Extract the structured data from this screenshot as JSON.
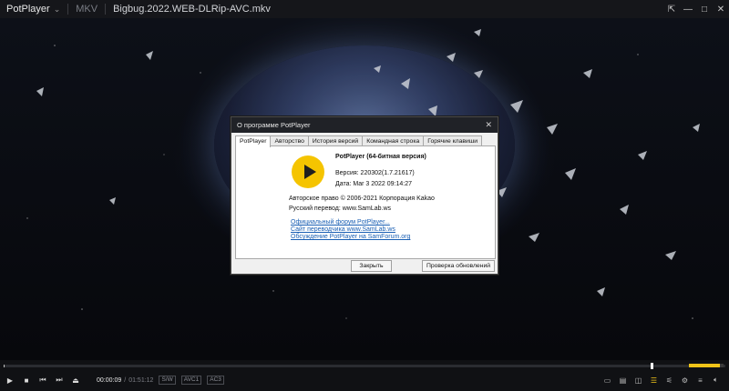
{
  "titlebar": {
    "app_name": "PotPlayer",
    "format": "MKV",
    "filename": "Bigbug.2022.WEB-DLRip-AVC.mkv",
    "controls": [
      "pin-icon",
      "minimize-icon",
      "maximize-icon",
      "close-icon"
    ]
  },
  "dialog": {
    "title": "О программе PotPlayer",
    "tabs": [
      {
        "label": "PotPlayer",
        "active": true
      },
      {
        "label": "Авторство",
        "active": false
      },
      {
        "label": "История версий",
        "active": false
      },
      {
        "label": "Командная строка",
        "active": false
      },
      {
        "label": "Горячие клавиши",
        "active": false
      }
    ],
    "app_name": "PotPlayer (64-битная версия)",
    "version": "Версия: 220302(1.7.21617)",
    "date": "Дата: Mar  3 2022 09:14:27",
    "copyright": "Авторское право © 2006-2021 Корпорация Kakao",
    "translation": "Русский перевод: www.SamLab.ws",
    "links": [
      "Официальный форум PotPlayer...",
      "Сайт переводчика www.SamLab.ws",
      "Обсуждение PotPlayer на SamForum.org"
    ],
    "buttons": {
      "close": "Закрыть",
      "update": "Проверка обновлений"
    }
  },
  "controls": {
    "current_time": "00:00:09",
    "total_time": "01:51:12",
    "badges": [
      "S/W",
      "AVC1",
      "AC3"
    ],
    "seek_progress": 0.0014,
    "volume": 0.9,
    "accent_color": "#f0c419"
  }
}
